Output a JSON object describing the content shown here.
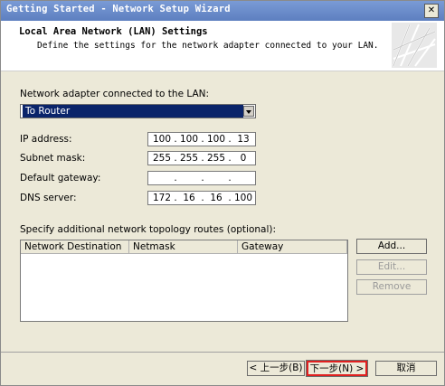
{
  "window": {
    "title": "Getting Started - Network Setup Wizard",
    "close_icon": "close-icon"
  },
  "header": {
    "title": "Local Area Network (LAN) Settings",
    "subtitle": "Define the settings for the network adapter connected to your LAN."
  },
  "adapter": {
    "label": "Network adapter connected to the LAN:",
    "selected": "To Router"
  },
  "fields": {
    "ip": {
      "label": "IP address:",
      "octets": [
        "100",
        "100",
        "100",
        "13"
      ]
    },
    "mask": {
      "label": "Subnet mask:",
      "octets": [
        "255",
        "255",
        "255",
        "0"
      ]
    },
    "gateway": {
      "label": "Default gateway:",
      "octets": [
        "",
        "",
        "",
        ""
      ]
    },
    "dns": {
      "label": "DNS server:",
      "octets": [
        "172",
        "16",
        "16",
        "100"
      ]
    }
  },
  "routes": {
    "label": "Specify additional network topology routes (optional):",
    "columns": [
      "Network Destination",
      "Netmask",
      "Gateway"
    ],
    "rows": []
  },
  "buttons": {
    "add": "Add...",
    "edit": "Edit...",
    "remove": "Remove",
    "back": "< 上一步(B)",
    "next": "下一步(N) >",
    "cancel": "取消"
  }
}
